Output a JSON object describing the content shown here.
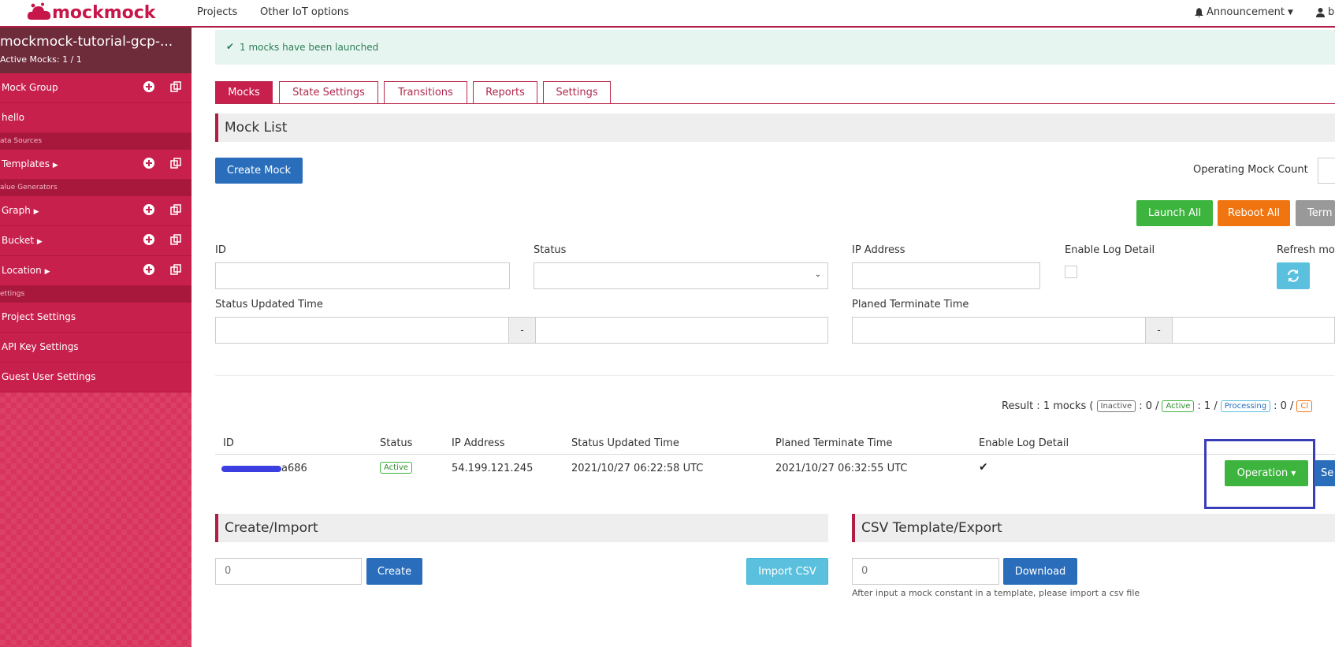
{
  "nav": {
    "logo_text": "mockmock",
    "links": [
      "Projects",
      "Other IoT options"
    ],
    "announcement": "Announcement",
    "user_initial": "b"
  },
  "sidebar": {
    "project_name": "mockmock-tutorial-gcp-...",
    "active_mocks": "Active Mocks: 1 / 1",
    "mock_group": "Mock Group",
    "group_item": "hello",
    "sec_data_sources": "ata Sources",
    "templates": "Templates",
    "sec_value_generators": "alue Generators",
    "graph": "Graph",
    "bucket": "Bucket",
    "location": "Location",
    "sec_settings": "ettings",
    "project_settings": "Project Settings",
    "api_key_settings": "API Key Settings",
    "guest_user_settings": "Guest User Settings"
  },
  "alert": {
    "text": "1 mocks have been launched"
  },
  "tabs": [
    "Mocks",
    "State Settings",
    "Transitions",
    "Reports",
    "Settings"
  ],
  "mock_list": {
    "title": "Mock List",
    "create_mock": "Create Mock",
    "operating_count_label": "Operating Mock Count",
    "launch_all": "Launch All",
    "reboot_all": "Reboot All",
    "terminate_all": "Term"
  },
  "filters": {
    "id": "ID",
    "status": "Status",
    "ip_address": "IP Address",
    "enable_log_detail": "Enable Log Detail",
    "refresh": "Refresh mo",
    "status_updated_time": "Status Updated Time",
    "planed_terminate_time": "Planed Terminate Time",
    "range_sep": "-"
  },
  "result": {
    "prefix": "Result : 1 mocks (",
    "inactive": "Inactive",
    "inactive_count": ": 0 /",
    "active": "Active",
    "active_count": ": 1 /",
    "processing": "Processing",
    "processing_count": ": 0 /",
    "more": "Cl"
  },
  "table": {
    "headers": [
      "ID",
      "Status",
      "IP Address",
      "Status Updated Time",
      "Planed Terminate Time",
      "Enable Log Detail"
    ],
    "row": {
      "id_suffix": "a686",
      "status": "Active",
      "ip": "54.199.121.245",
      "updated": "2021/10/27 06:22:58 UTC",
      "terminate": "2021/10/27 06:32:55 UTC",
      "log_check": "✔"
    },
    "operation": "Operation",
    "second_btn": "Se"
  },
  "create_import": {
    "title": "Create/Import",
    "count": "0",
    "create": "Create",
    "import_csv": "Import CSV"
  },
  "csv": {
    "title": "CSV Template/Export",
    "count": "0",
    "download": "Download",
    "note": "After input a mock constant in a template, please import a csv file"
  },
  "colors": {
    "brand": "#c8204c",
    "green": "#3db43d",
    "orange": "#f07511",
    "blue": "#2a6ebb",
    "info": "#5bc0de",
    "highlight": "#3a3db8"
  }
}
